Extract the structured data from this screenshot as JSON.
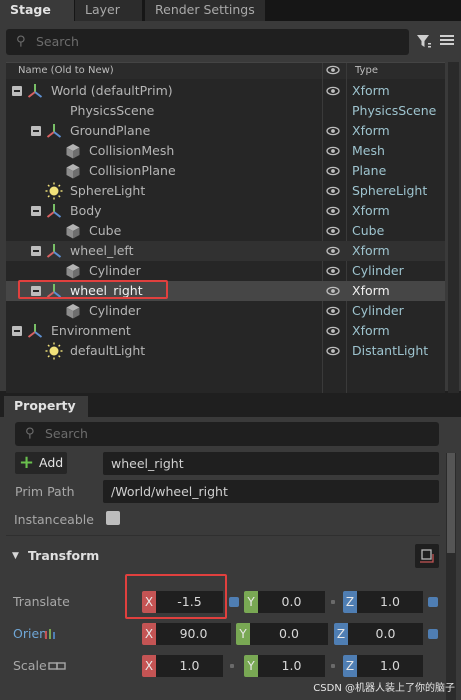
{
  "tabs": [
    {
      "label": "Stage",
      "active": true
    },
    {
      "label": "Layer",
      "active": false
    },
    {
      "label": "Render Settings",
      "active": false
    }
  ],
  "stage": {
    "search_placeholder": "Search",
    "columns": {
      "name": "Name (Old to New)",
      "type": "Type"
    },
    "rows": [
      {
        "name": "World (defaultPrim)",
        "type": "Xform",
        "icon": "xform-icon",
        "depth": 0,
        "expander": true,
        "eye": true
      },
      {
        "name": "PhysicsScene",
        "type": "PhysicsScene",
        "icon": "physics-scene-icon",
        "depth": 1,
        "expander": false,
        "eye": false
      },
      {
        "name": "GroundPlane",
        "type": "Xform",
        "icon": "xform-icon",
        "depth": 1,
        "expander": true,
        "eye": true
      },
      {
        "name": "CollisionMesh",
        "type": "Mesh",
        "icon": "mesh-cube-icon",
        "depth": 2,
        "expander": false,
        "eye": true
      },
      {
        "name": "CollisionPlane",
        "type": "Plane",
        "icon": "mesh-cube-icon",
        "depth": 2,
        "expander": false,
        "eye": true
      },
      {
        "name": "SphereLight",
        "type": "SphereLight",
        "icon": "light-icon",
        "depth": 1,
        "expander": false,
        "eye": true
      },
      {
        "name": "Body",
        "type": "Xform",
        "icon": "xform-icon",
        "depth": 1,
        "expander": true,
        "eye": true
      },
      {
        "name": "Cube",
        "type": "Cube",
        "icon": "mesh-cube-icon",
        "depth": 2,
        "expander": false,
        "eye": true
      },
      {
        "name": "wheel_left",
        "type": "Xform",
        "icon": "xform-icon",
        "depth": 1,
        "expander": true,
        "eye": true
      },
      {
        "name": "Cylinder",
        "type": "Cylinder",
        "icon": "mesh-cube-icon",
        "depth": 2,
        "expander": false,
        "eye": true
      },
      {
        "name": "wheel_right",
        "type": "Xform",
        "icon": "xform-icon",
        "depth": 1,
        "expander": true,
        "eye": true
      },
      {
        "name": "Cylinder",
        "type": "Cylinder",
        "icon": "mesh-cube-icon",
        "depth": 2,
        "expander": false,
        "eye": true
      },
      {
        "name": "Environment",
        "type": "Xform",
        "icon": "xform-icon",
        "depth": 0,
        "expander": true,
        "eye": true
      },
      {
        "name": "defaultLight",
        "type": "DistantLight",
        "icon": "light-icon",
        "depth": 1,
        "expander": false,
        "eye": true
      }
    ],
    "selected_row": 10
  },
  "property": {
    "tab_label": "Property",
    "search_placeholder": "Search",
    "add_label": "Add",
    "prim_name": "wheel_right",
    "prim_path_label": "Prim Path",
    "prim_path": "/World/wheel_right",
    "instanceable_label": "Instanceable",
    "transform_label": "Transform",
    "translate": {
      "label": "Translate",
      "x": "-1.5",
      "y": "0.0",
      "z": "1.0"
    },
    "orient": {
      "label": "Orien",
      "x": "90.0",
      "y": "0.0",
      "z": "0.0"
    },
    "scale": {
      "label": "Scale",
      "x": "1.0",
      "y": "1.0",
      "z": "1.0"
    }
  },
  "watermark": "CSDN @机器人装上了你的脑子",
  "colors": {
    "x_axis": "#c45454",
    "y_axis": "#79a854",
    "z_axis": "#4f7eb3",
    "highlight": "#e0403e"
  }
}
